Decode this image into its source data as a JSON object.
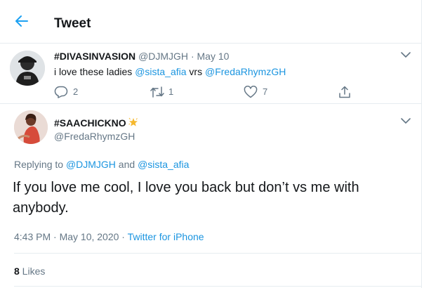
{
  "header": {
    "title": "Tweet"
  },
  "parent_tweet": {
    "display_name": "#DIVASINVASION",
    "handle": "@DJMJGH",
    "separator": "·",
    "date": "May 10",
    "text_prefix": "i love these ladies ",
    "mention_1": "@sista_afia",
    "text_middle": " vrs ",
    "mention_2": "@FredaRhymzGH",
    "replies": "2",
    "retweets": "1",
    "likes": "7"
  },
  "main_tweet": {
    "display_name": "#SAACHICKNO",
    "handle": "@FredaRhymzGH",
    "replying_label": "Replying to ",
    "replying_mention_1": "@DJMJGH",
    "replying_and": " and ",
    "replying_mention_2": "@sista_afia",
    "text": "If you love me cool, I love you back but don’t vs me with anybody.",
    "time_date": "4:43 PM · May 10, 2020 · ",
    "source": "Twitter for iPhone",
    "likes_count": "8",
    "likes_label": " Likes"
  },
  "icons": {
    "back": "arrow-left-icon",
    "more": "chevron-down-icon",
    "reply": "reply-bubble-icon",
    "retweet": "retweet-icon",
    "like": "heart-icon",
    "share": "share-icon",
    "emoji": "glowing-star-icon"
  },
  "colors": {
    "accent": "#1da1f2",
    "link": "#1b95e0",
    "text": "#14171a",
    "muted": "#657786",
    "border": "#e6ecf0"
  }
}
